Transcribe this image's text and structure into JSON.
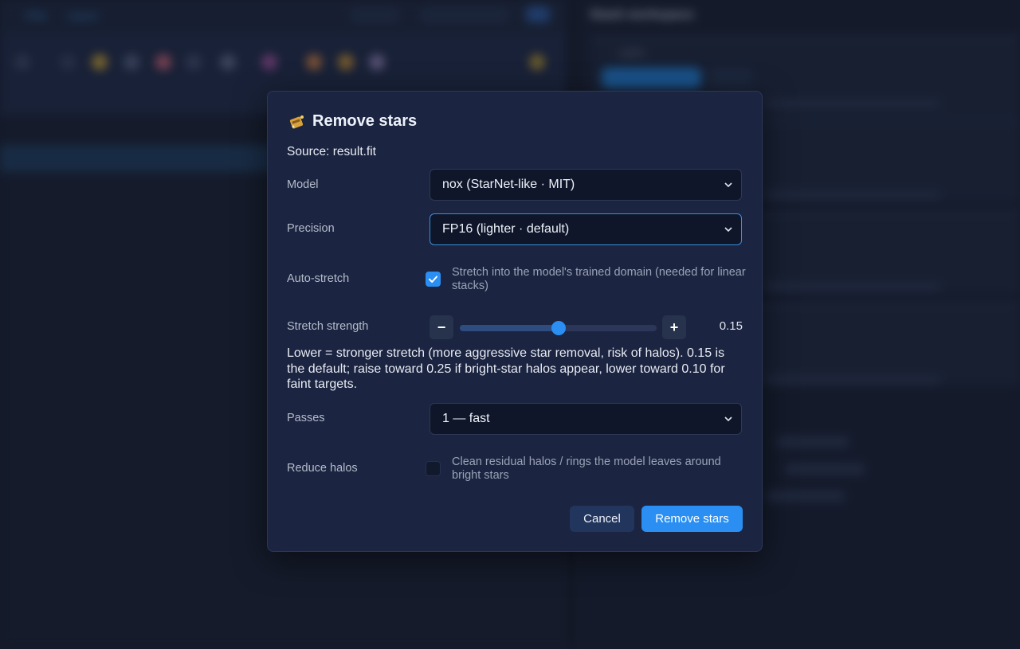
{
  "background": {
    "links": [
      "Files",
      "Layers"
    ],
    "right_title": "Stash workspace",
    "right_tab": "Lights"
  },
  "dialog": {
    "title": "Remove stars",
    "title_icon": "broom-stars-icon",
    "source": "Source: result.fit",
    "model": {
      "label": "Model",
      "value": "nox (StarNet-like · MIT)"
    },
    "precision": {
      "label": "Precision",
      "value": "FP16 (lighter · default)"
    },
    "auto_stretch": {
      "label": "Auto-stretch",
      "checked": true,
      "description": "Stretch into the model's trained domain (needed for linear stacks)"
    },
    "stretch_strength": {
      "label": "Stretch strength",
      "minus": "−",
      "plus": "+",
      "value": 0.15,
      "value_text": "0.15",
      "min": 0.0,
      "max": 0.3
    },
    "help_text": "Lower = stronger stretch (more aggressive star removal, risk of halos). 0.15 is the default; raise toward 0.25 if bright-star halos appear, lower toward 0.10 for faint targets.",
    "passes": {
      "label": "Passes",
      "value": "1 — fast"
    },
    "reduce_halos": {
      "label": "Reduce halos",
      "checked": false,
      "description": "Clean residual halos / rings the model leaves around bright stars"
    },
    "cancel_label": "Cancel",
    "confirm_label": "Remove stars"
  },
  "colors": {
    "accent": "#2a8ef2",
    "dialog_bg": "#1b2440",
    "input_bg": "#0f1629"
  }
}
